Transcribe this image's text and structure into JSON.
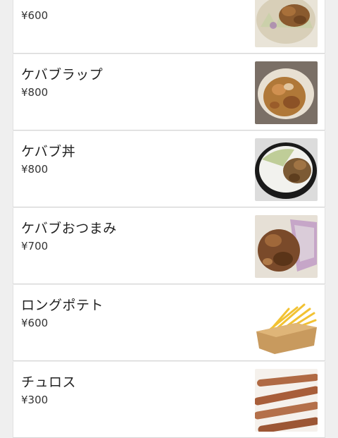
{
  "menu": {
    "items": [
      {
        "name": "",
        "price": "¥600",
        "image": "kebab-plate-image"
      },
      {
        "name": "ケバブラップ",
        "price": "¥800",
        "image": "kebab-wrap-image"
      },
      {
        "name": "ケバブ丼",
        "price": "¥800",
        "image": "kebab-rice-bowl-image"
      },
      {
        "name": "ケバブおつまみ",
        "price": "¥700",
        "image": "kebab-snack-image"
      },
      {
        "name": "ロングポテト",
        "price": "¥600",
        "image": "long-fries-image"
      },
      {
        "name": "チュロス",
        "price": "¥300",
        "image": "churros-image"
      }
    ]
  }
}
